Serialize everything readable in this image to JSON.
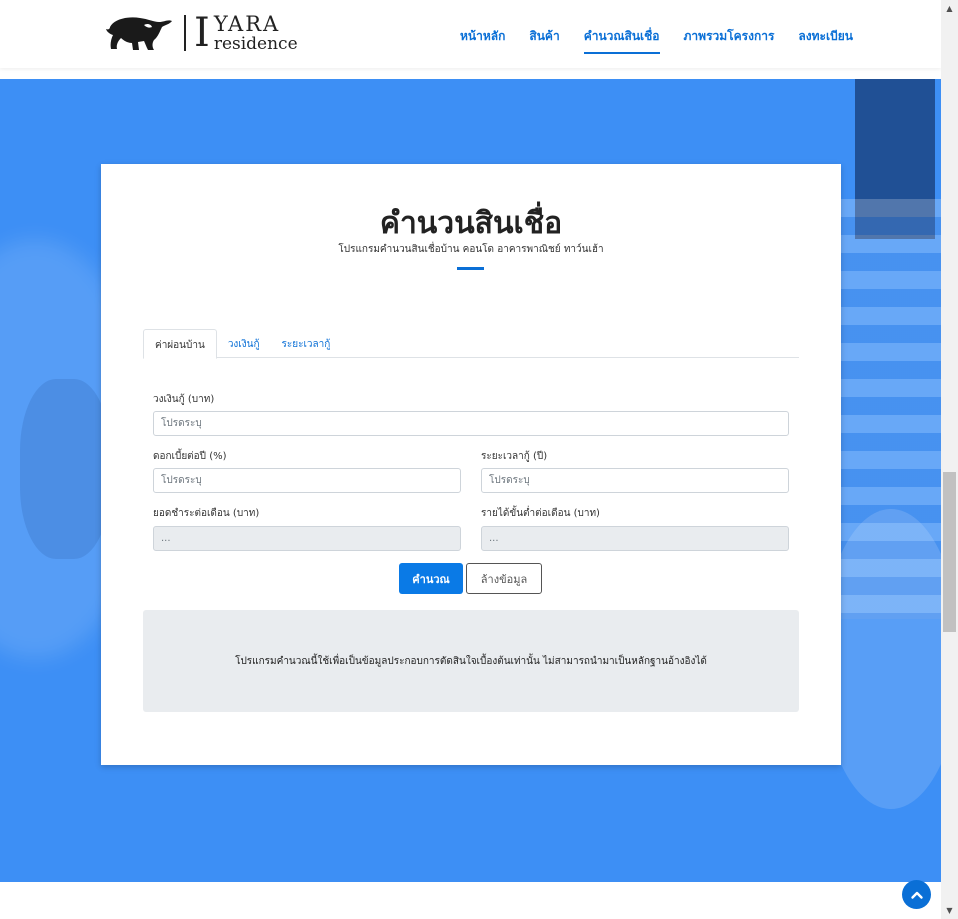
{
  "brand": {
    "mark": "I",
    "name": "YARA",
    "tagline": "residence"
  },
  "nav": {
    "items": [
      {
        "label": "หน้าหลัก"
      },
      {
        "label": "สินค้า"
      },
      {
        "label": "คำนวณสินเชื่อ",
        "active": true
      },
      {
        "label": "ภาพรวมโครงการ"
      },
      {
        "label": "ลงทะเบียน"
      }
    ]
  },
  "calculator": {
    "title": "คำนวนสินเชื่อ",
    "subtitle": "โปรแกรมคำนวนสินเชื่อบ้าน คอนโด อาคารพาณิชย์ ทาว์นเฮ้า",
    "tabs": [
      {
        "label": "ค่าผ่อนบ้าน",
        "active": true
      },
      {
        "label": "วงเงินกู้"
      },
      {
        "label": "ระยะเวลากู้"
      }
    ],
    "fields": {
      "loan_amount": {
        "label": "วงเงินกู้ (บาท)",
        "placeholder": "โปรดระบุ",
        "value": ""
      },
      "interest": {
        "label": "ดอกเบี้ยต่อปี (%)",
        "placeholder": "โปรดระบุ",
        "value": ""
      },
      "term": {
        "label": "ระยะเวลากู้ (ปี)",
        "placeholder": "โปรดระบุ",
        "value": ""
      },
      "monthly_payment": {
        "label": "ยอดชำระต่อเดือน (บาท)",
        "placeholder": "...",
        "value": ""
      },
      "min_income": {
        "label": "รายได้ขั้นต่ำต่อเดือน (บาท)",
        "placeholder": "...",
        "value": ""
      }
    },
    "buttons": {
      "calculate": "คำนวณ",
      "clear": "ล้างข้อมูล"
    },
    "notice": "โปรแกรมคำนวณนี้ใช้เพื่อเป็นข้อมูลประกอบการตัดสินใจเบื้องต้นเท่านั้น ไม่สามารถนำมาเป็นหลักฐานอ้างอิงได้"
  },
  "colors": {
    "accent": "#0a6fd6",
    "hero": "#3d8ff5",
    "readonly": "#e9ecef"
  },
  "icons": {
    "back_to_top": "chevron-up-icon",
    "logo": "elephant-icon"
  }
}
